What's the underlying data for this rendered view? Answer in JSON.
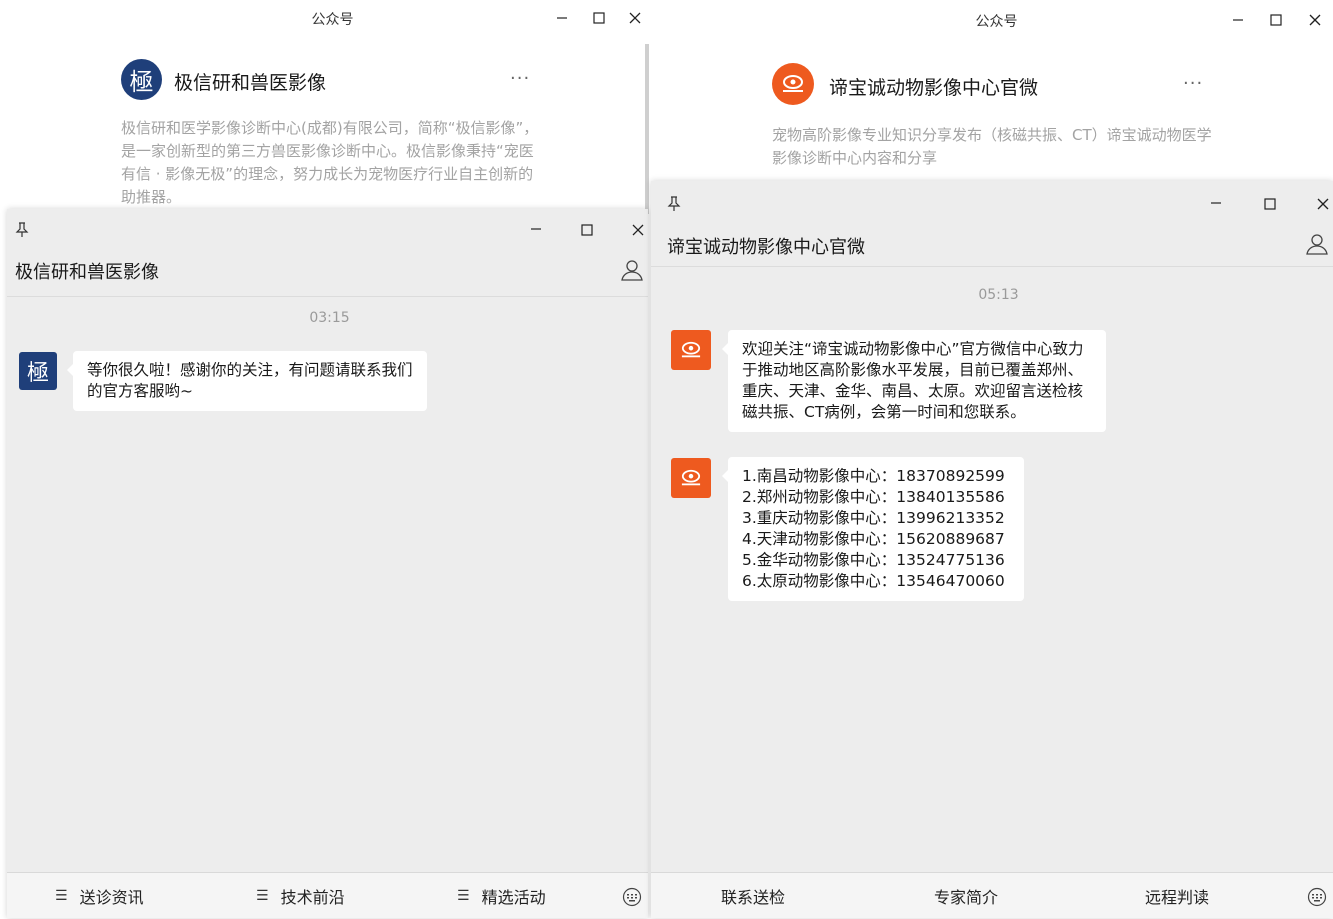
{
  "left_back": {
    "title": "公众号",
    "account_name": "极信研和兽医影像",
    "more": "···",
    "description": "极信研和医学影像诊断中心(成都)有限公司，简称“极信影像”，是一家创新型的第三方兽医影像诊断中心。极信影像秉持“宠医有信 · 影像无极”的理念，努力成长为宠物医疗行业自主创新的助推器。",
    "logo_glyph": "極"
  },
  "right_back": {
    "title": "公众号",
    "account_name": "谛宝诚动物影像中心官微",
    "more": "···",
    "description": "宠物高阶影像专业知识分享发布（核磁共振、CT）谛宝诚动物医学影像诊断中心内容和分享"
  },
  "left_chat": {
    "title": "极信研和兽医影像",
    "time": "03:15",
    "messages": [
      {
        "text": "等你很久啦！感谢你的关注，有问题请联系我们的官方客服哟~"
      }
    ],
    "menu": [
      {
        "label": "送诊资讯"
      },
      {
        "label": "技术前沿"
      },
      {
        "label": "精选活动"
      }
    ]
  },
  "right_chat": {
    "title": "谛宝诚动物影像中心官微",
    "time": "05:13",
    "messages": [
      {
        "text": "欢迎关注“谛宝诚动物影像中心”官方微信中心致力于推动地区高阶影像水平发展，目前已覆盖郑州、重庆、天津、金华、南昌、太原。欢迎留言送检核磁共振、CT病例，会第一时间和您联系。"
      },
      {
        "lines": [
          "1.南昌动物影像中心：18370892599",
          "2.郑州动物影像中心：13840135586",
          "3.重庆动物影像中心：13996213352",
          "4.天津动物影像中心：15620889687",
          "5.金华动物影像中心：13524775136",
          "6.太原动物影像中心：13546470060"
        ]
      }
    ],
    "menu": [
      {
        "label": "联系送检"
      },
      {
        "label": "专家简介"
      },
      {
        "label": "远程判读"
      }
    ]
  },
  "icons": {
    "pin": "pin-icon",
    "minimize": "minimize-icon",
    "maximize": "maximize-icon",
    "close": "close-icon",
    "profile": "profile-icon",
    "keyboard": "keyboard-icon",
    "menu": "hamburger-icon"
  },
  "colors": {
    "left_logo": "#1f3f7a",
    "right_logo": "#ee5a1f",
    "chat_bg": "#ededed",
    "bubble": "#ffffff"
  }
}
